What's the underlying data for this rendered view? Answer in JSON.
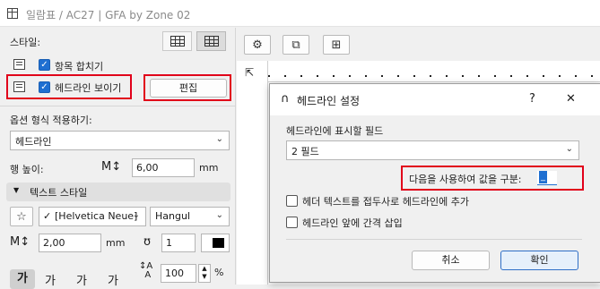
{
  "window": {
    "title": "일람표 / AC27 | GFA by Zone 02"
  },
  "left_panel": {
    "style_label": "스타일:",
    "merge_items_label": "항목 합치기",
    "show_headline_label": "헤드라인 보이기",
    "edit_button": "편집",
    "option_apply_label": "옵션 형식 적용하기:",
    "option_apply_value": "헤드라인",
    "row_height_label": "행 높이:",
    "row_height_value": "6,00",
    "row_height_unit": "mm",
    "text_style_label": "텍스트 스타일",
    "font_value": "[Helvetica Neue]",
    "script_value": "Hangul",
    "font_size_value": "2,00",
    "font_size_unit": "mm",
    "pen_value": "1",
    "scale_value": "100",
    "scale_unit": "%",
    "glyphs": [
      "가",
      "가",
      "가",
      "가"
    ]
  },
  "dialog": {
    "title": "헤드라인 설정",
    "help": "?",
    "close": "✕",
    "fields_label": "헤드라인에 표시할 필드",
    "fields_value": "2 필드",
    "separator_label": "다음을 사용하여 값을 구분:",
    "separator_value": "_",
    "prefix_checkbox": "헤더 텍스트를 접두사로 헤드라인에 추가",
    "space_checkbox": "헤드라인 앞에 간격 삽입",
    "cancel": "취소",
    "ok": "확인"
  },
  "colors": {
    "accent": "#1f6fd1",
    "highlight": "#e1001a"
  }
}
